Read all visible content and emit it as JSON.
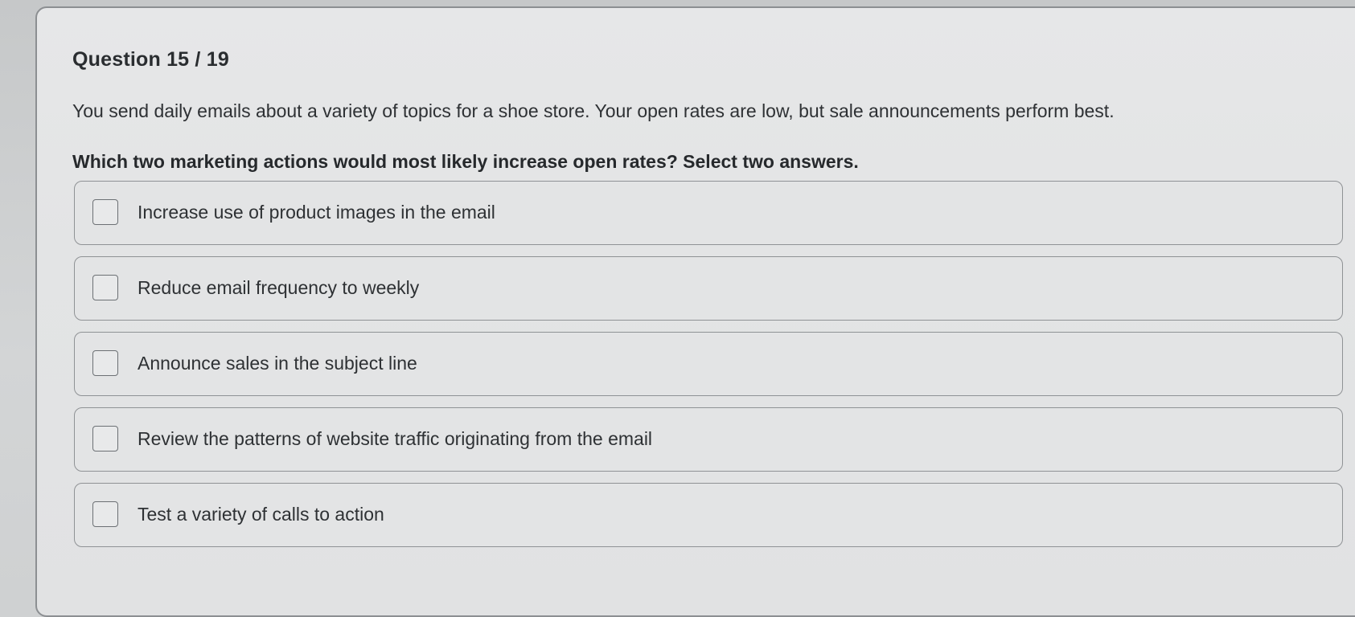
{
  "question": {
    "number_label": "Question 15 / 19",
    "prompt": "You send daily emails about a variety of topics for a shoe store. Your open rates are low, but sale announcements perform best.",
    "instruction": "Which two marketing actions would most likely increase open rates? Select two answers."
  },
  "options": [
    {
      "label": "Increase use of product images in the email",
      "checked": false
    },
    {
      "label": "Reduce email frequency to weekly",
      "checked": false
    },
    {
      "label": "Announce sales in the subject line",
      "checked": false
    },
    {
      "label": "Review the patterns of website traffic originating from the email",
      "checked": false
    },
    {
      "label": "Test a variety of calls to action",
      "checked": false
    }
  ]
}
